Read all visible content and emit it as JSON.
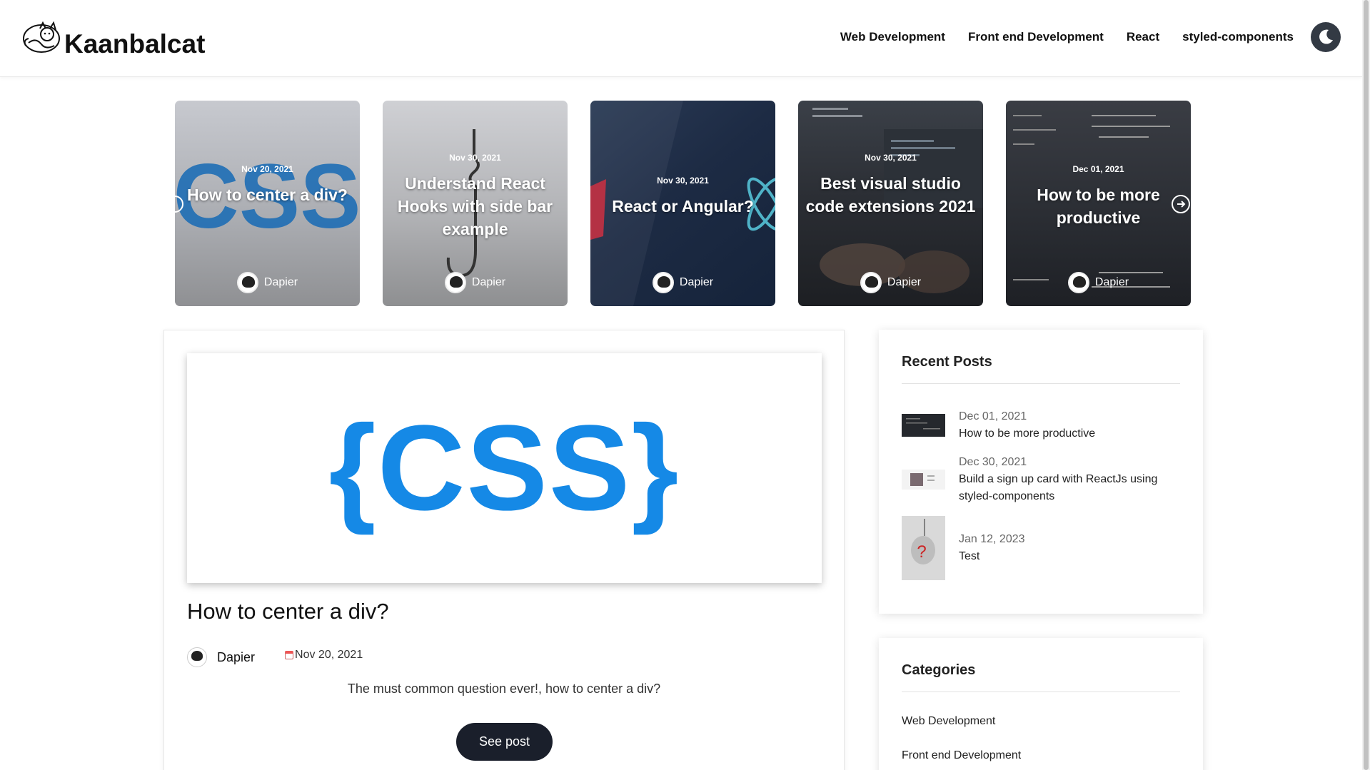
{
  "brand": {
    "name": "Kaanbalcat"
  },
  "nav": {
    "items": [
      {
        "label": "Web Development"
      },
      {
        "label": "Front end Development"
      },
      {
        "label": "React"
      },
      {
        "label": "styled-components"
      }
    ]
  },
  "slider": {
    "cards": [
      {
        "date": "Nov 20, 2021",
        "title": "How to center a div?",
        "author": "Dapier"
      },
      {
        "date": "Nov 30, 2021",
        "title": "Understand React Hooks with side bar example",
        "author": "Dapier"
      },
      {
        "date": "Nov 30, 2021",
        "title": "React or Angular?",
        "author": "Dapier"
      },
      {
        "date": "Nov 30, 2021",
        "title": "Best visual studio code extensions 2021",
        "author": "Dapier"
      },
      {
        "date": "Dec 01, 2021",
        "title": "How to be more productive",
        "author": "Dapier"
      }
    ]
  },
  "post": {
    "image_text": "{CSS}",
    "title": "How to center a div?",
    "author": "Dapier",
    "date": "Nov 20, 2021",
    "excerpt": "The must common question ever!, how to center a div?",
    "button": "See post"
  },
  "recent_posts": {
    "title": "Recent Posts",
    "items": [
      {
        "date": "Dec 01, 2021",
        "title": "How to be more productive"
      },
      {
        "date": "Dec 30, 2021",
        "title": "Build a sign up card with ReactJs using styled-components"
      },
      {
        "date": "Jan 12, 2023",
        "title": "Test"
      }
    ]
  },
  "categories": {
    "title": "Categories",
    "items": [
      {
        "label": "Web Development"
      },
      {
        "label": "Front end Development"
      }
    ]
  },
  "colors": {
    "accent_dark": "#1a1f2b",
    "css_blue": "#1589e6",
    "toggle": "#333a44"
  }
}
